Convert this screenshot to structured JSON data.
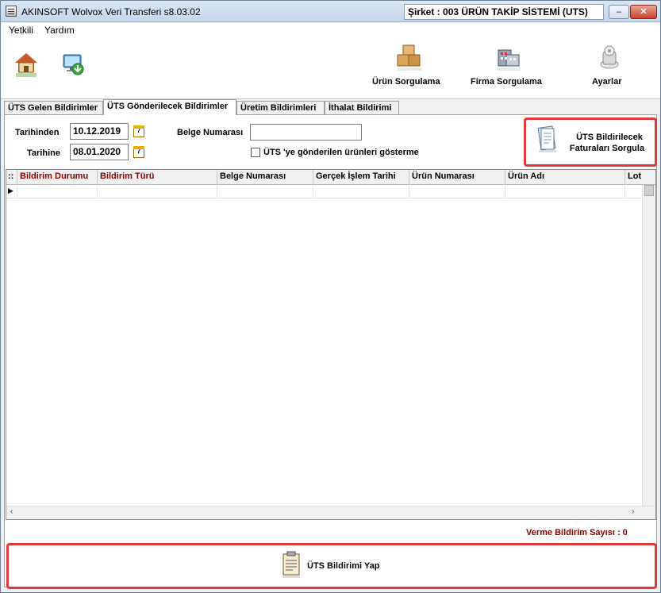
{
  "window": {
    "title": "AKINSOFT Wolvox Veri Transferi s8.03.02",
    "company": "Şirket : 003 ÜRÜN TAKİP SİSTEMİ (UTS)",
    "minimize": "–",
    "maximize": "□",
    "close": "✕"
  },
  "menu": [
    "Yetkili",
    "Yardım"
  ],
  "toolbar": {
    "product_query": "Ürün Sorgulama",
    "company_query": "Firma Sorgulama",
    "settings": "Ayarlar"
  },
  "tabs": [
    "ÜTS Gelen Bildirimler",
    "ÜTS Gönderilecek Bildirimler",
    "Üretim Bildirimleri",
    "İthalat Bildirimi"
  ],
  "filters": {
    "date_from_label": "Tarihinden",
    "date_from": "10.12.2019",
    "date_to_label": "Tarihine",
    "date_to": "08.01.2020",
    "calendar_glyph": "7",
    "doc_number_label": "Belge Numarası",
    "doc_number": "",
    "show_sent_label": "ÜTS 'ye gönderilen ürünleri gösterme"
  },
  "query_button": {
    "line1": "ÜTS Bildirilecek",
    "line2": "Faturaları Sorgula"
  },
  "grid": {
    "indicator": "::",
    "row_marker": "▶",
    "columns": [
      "Bildirim Durumu",
      "Bildirim Türü",
      "Belge Numarası",
      "Gerçek İşlem Tarihi",
      "Ürün Numarası",
      "Ürün Adı",
      "Lot"
    ],
    "scroll_left": "‹",
    "scroll_right": "›"
  },
  "status": {
    "count_text": "Verme Bildirim Sayısı : 0"
  },
  "send_button": "ÜTS Bildirimi Yap",
  "colors": {
    "highlight": "#e03a3a",
    "header_red": "#8b0000"
  }
}
